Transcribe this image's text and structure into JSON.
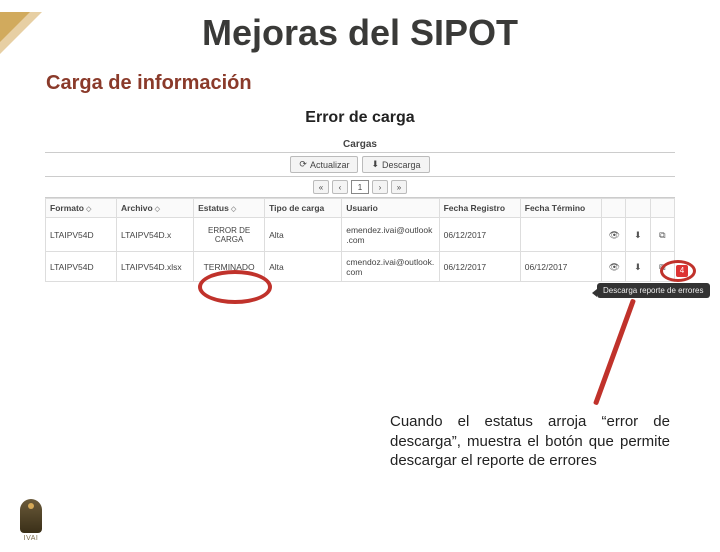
{
  "title": "Mejoras del SIPOT",
  "subtitle": "Carga de información",
  "section_label": "Error de carga",
  "panel_title": "Cargas",
  "toolbar": {
    "refresh_label": "Actualizar",
    "download_label": "Descarga"
  },
  "pager": {
    "current": "1"
  },
  "columns": [
    "Formato",
    "Archivo",
    "Estatus",
    "Tipo de carga",
    "Usuario",
    "Fecha Registro",
    "Fecha Término"
  ],
  "rows": [
    {
      "formato": "LTAIPV54D",
      "archivo": "LTAIPV54D.x",
      "estatus": "ERROR DE CARGA",
      "tipo": "Alta",
      "usuario": "emendez.ivai@outlook.com",
      "fecha_reg": "06/12/2017",
      "fecha_term": ""
    },
    {
      "formato": "LTAIPV54D",
      "archivo": "LTAIPV54D.xlsx",
      "estatus": "TERMINADO",
      "tipo": "Alta",
      "usuario": "cmendoz.ivai@outlook.com",
      "fecha_reg": "06/12/2017",
      "fecha_term": "06/12/2017"
    }
  ],
  "badge": "4",
  "tooltip": "Descarga reporte de errores",
  "caption": "Cuando el estatus arroja “error de descarga”, muestra el botón que permite descargar el reporte de errores",
  "logo_text": "IVAI"
}
